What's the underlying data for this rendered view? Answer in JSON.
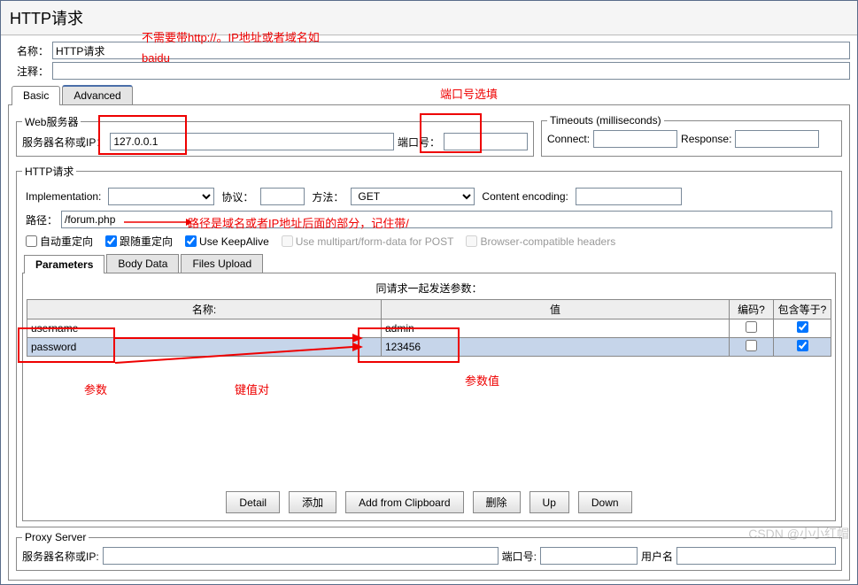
{
  "title": "HTTP请求",
  "nameLabel": "名称：",
  "nameValue": "HTTP请求",
  "commentLabel": "注释：",
  "commentValue": "",
  "tabs": {
    "basic": "Basic",
    "advanced": "Advanced"
  },
  "webServer": {
    "legend": "Web服务器",
    "serverLabel": "服务器名称或IP：",
    "serverValue": "127.0.0.1",
    "portLabel": "端口号：",
    "portValue": ""
  },
  "timeouts": {
    "legend": "Timeouts (milliseconds)",
    "connectLabel": "Connect:",
    "connectValue": "",
    "responseLabel": "Response:",
    "responseValue": ""
  },
  "http": {
    "legend": "HTTP请求",
    "implLabel": "Implementation:",
    "implValue": "",
    "protoLabel": "协议：",
    "protoValue": "",
    "methodLabel": "方法：",
    "methodValue": "GET",
    "encodingLabel": "Content encoding:",
    "encodingValue": "",
    "pathLabel": "路径：",
    "pathValue": "/forum.php"
  },
  "checks": {
    "autoRedirect": "自动重定向",
    "followRedirect": "跟随重定向",
    "keepAlive": "Use KeepAlive",
    "multipart": "Use multipart/form-data for POST",
    "browserHeaders": "Browser-compatible headers"
  },
  "subtabs": {
    "params": "Parameters",
    "body": "Body Data",
    "files": "Files Upload"
  },
  "paramsPanel": {
    "title": "同请求一起发送参数：",
    "colName": "名称:",
    "colValue": "值",
    "colEncode": "编码?",
    "colInclude": "包含等于?",
    "rows": [
      {
        "name": "username",
        "value": "admin",
        "encode": false,
        "include": true
      },
      {
        "name": "password",
        "value": "123456",
        "encode": false,
        "include": true
      }
    ]
  },
  "buttons": {
    "detail": "Detail",
    "add": "添加",
    "clipboard": "Add from Clipboard",
    "delete": "删除",
    "up": "Up",
    "down": "Down"
  },
  "proxy": {
    "legend": "Proxy Server",
    "serverLabel": "服务器名称或IP:",
    "portLabel": "端口号:",
    "userLabel": "用户名"
  },
  "annotations": {
    "topNote1": "不需要带http://。IP地址或者域名如",
    "topNote2": "baidu",
    "portNote": "端口号选填",
    "pathNote": "路径是域名或者IP地址后面的部分，记住带/",
    "paramLabel": "参数",
    "kvLabel": "键值对",
    "valueLabel": "参数值"
  },
  "watermark": "CSDN @小小红帽"
}
